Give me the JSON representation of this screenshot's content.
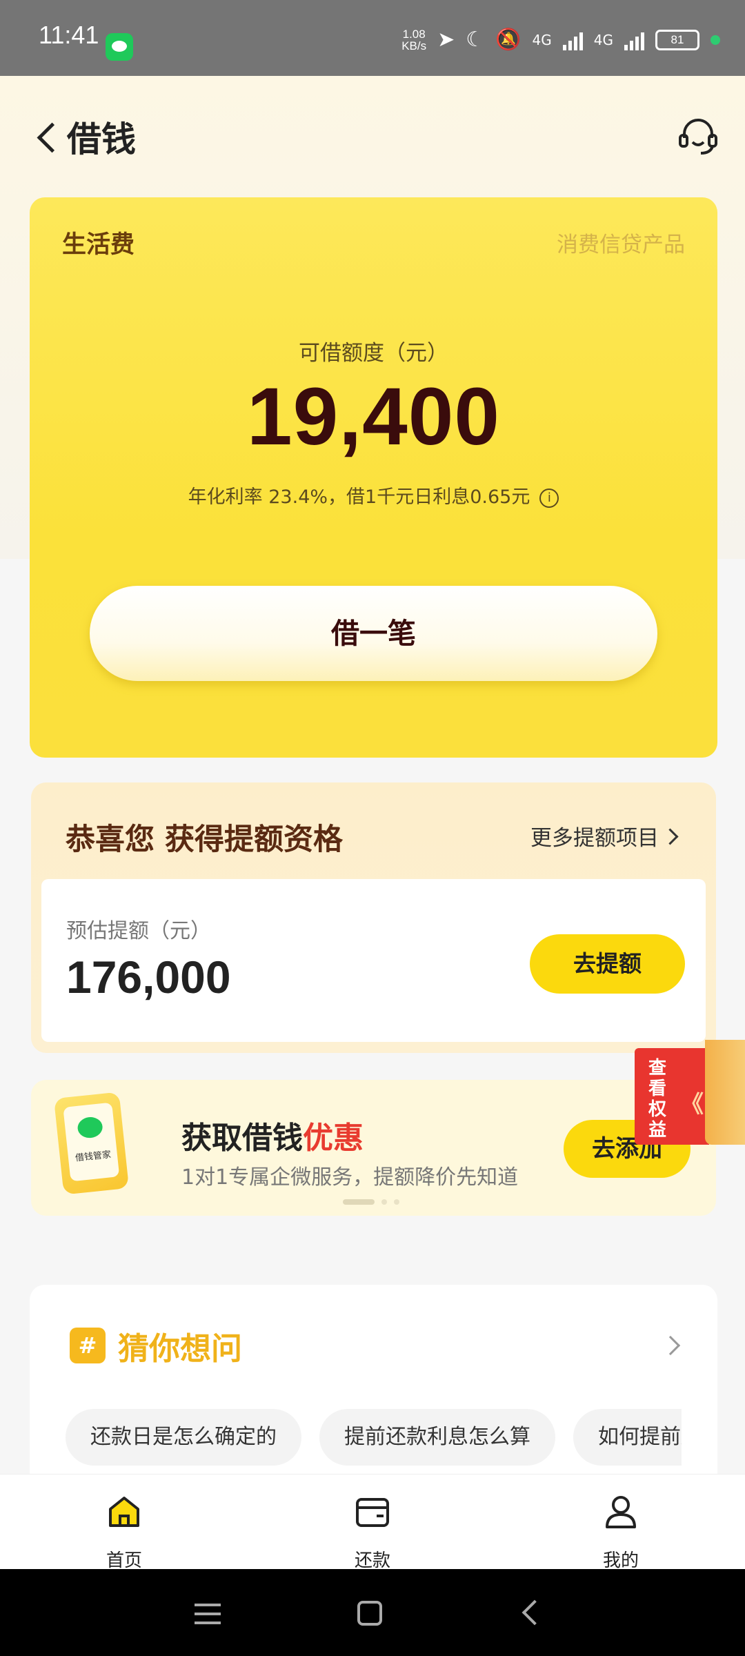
{
  "status_bar": {
    "time": "11:41",
    "net_speed": "1.08",
    "net_unit": "KB/s",
    "signal1_label": "4G",
    "signal2_label": "4G",
    "battery": "81"
  },
  "header": {
    "title": "借钱"
  },
  "loan_card": {
    "category": "生活费",
    "product_type": "消费信贷产品",
    "amount_label": "可借额度（元）",
    "amount": "19,400",
    "rate_text": "年化利率  23.4%，借1千元日利息0.65元",
    "info_glyph": "i",
    "borrow_button": "借一笔"
  },
  "quota_card": {
    "title": "恭喜您 获得提额资格",
    "more_link": "更多提额项目",
    "estimate_label": "预估提额（元）",
    "estimate_amount": "176,000",
    "raise_button": "去提额"
  },
  "side_ribbon": {
    "text": "查看权益",
    "arrow": "《"
  },
  "promo": {
    "phone_label": "借钱管家",
    "title_main": "获取借钱",
    "title_highlight": "优惠",
    "subtitle": "1对1专属企微服务，提额降价先知道",
    "add_button": "去添加"
  },
  "faq": {
    "icon": "#",
    "title": "猜你想问",
    "chips": [
      "还款日是怎么确定的",
      "提前还款利息怎么算",
      "如何提前还款"
    ]
  },
  "bottom_nav": {
    "items": [
      {
        "label": "首页",
        "icon": "home-icon"
      },
      {
        "label": "还款",
        "icon": "wallet-icon"
      },
      {
        "label": "我的",
        "icon": "person-icon"
      }
    ]
  },
  "colors": {
    "accent_yellow": "#fbd90d",
    "card_yellow": "#fbe13a",
    "highlight_red": "#e83b2f",
    "faq_gold": "#f0b21a"
  }
}
